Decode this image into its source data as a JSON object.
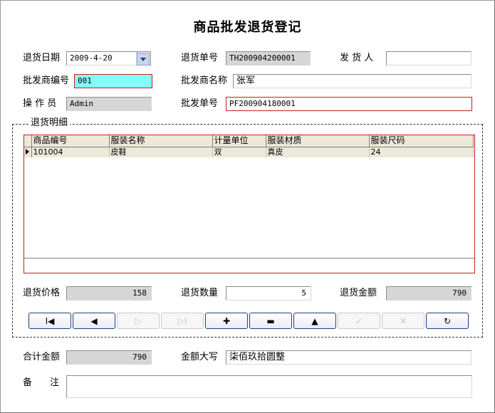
{
  "title": "商品批发退货登记",
  "form": {
    "return_date_label": "退货日期",
    "return_date_value": "2009-4-20",
    "return_no_label": "退货单号",
    "return_no_value": "TH200904200001",
    "shipper_label": "发 货 人",
    "shipper_value": "",
    "wholesaler_code_label": "批发商编号",
    "wholesaler_code_value": "001",
    "wholesaler_name_label": "批发商名称",
    "wholesaler_name_value": "张军",
    "operator_label": "操 作 员",
    "operator_value": "Admin",
    "wholesale_no_label": "批发单号",
    "wholesale_no_value": "PF200904180001"
  },
  "details": {
    "group_title": "退货明细",
    "columns": [
      "商品编号",
      "服装名称",
      "计量单位",
      "服装材质",
      "服装尺码"
    ],
    "rows": [
      [
        "101004",
        "皮鞋",
        "双",
        "真皮",
        "24"
      ]
    ],
    "price_label": "退货价格",
    "price_value": "158",
    "qty_label": "退货数量",
    "qty_value": "5",
    "amount_label": "退货金额",
    "amount_value": "790"
  },
  "nav_buttons": [
    {
      "glyph": "I◀",
      "enabled": true,
      "icon": "first-record-icon"
    },
    {
      "glyph": "◀",
      "enabled": true,
      "icon": "prev-record-icon"
    },
    {
      "glyph": "▷",
      "enabled": false,
      "icon": "next-record-icon"
    },
    {
      "glyph": "▷I",
      "enabled": false,
      "icon": "last-record-icon"
    },
    {
      "glyph": "✚",
      "enabled": true,
      "icon": "insert-icon"
    },
    {
      "glyph": "▬",
      "enabled": true,
      "icon": "delete-icon"
    },
    {
      "glyph": "▲",
      "enabled": true,
      "icon": "edit-icon"
    },
    {
      "glyph": "✓",
      "enabled": false,
      "icon": "post-icon"
    },
    {
      "glyph": "✕",
      "enabled": false,
      "icon": "cancel-icon"
    },
    {
      "glyph": "↻",
      "enabled": true,
      "icon": "refresh-icon"
    }
  ],
  "footer": {
    "total_label": "合计金额",
    "total_value": "790",
    "uppercase_label": "金额大写",
    "uppercase_value": "柒佰玖拾圆整",
    "remark_label": "备　注",
    "remark_value": ""
  }
}
